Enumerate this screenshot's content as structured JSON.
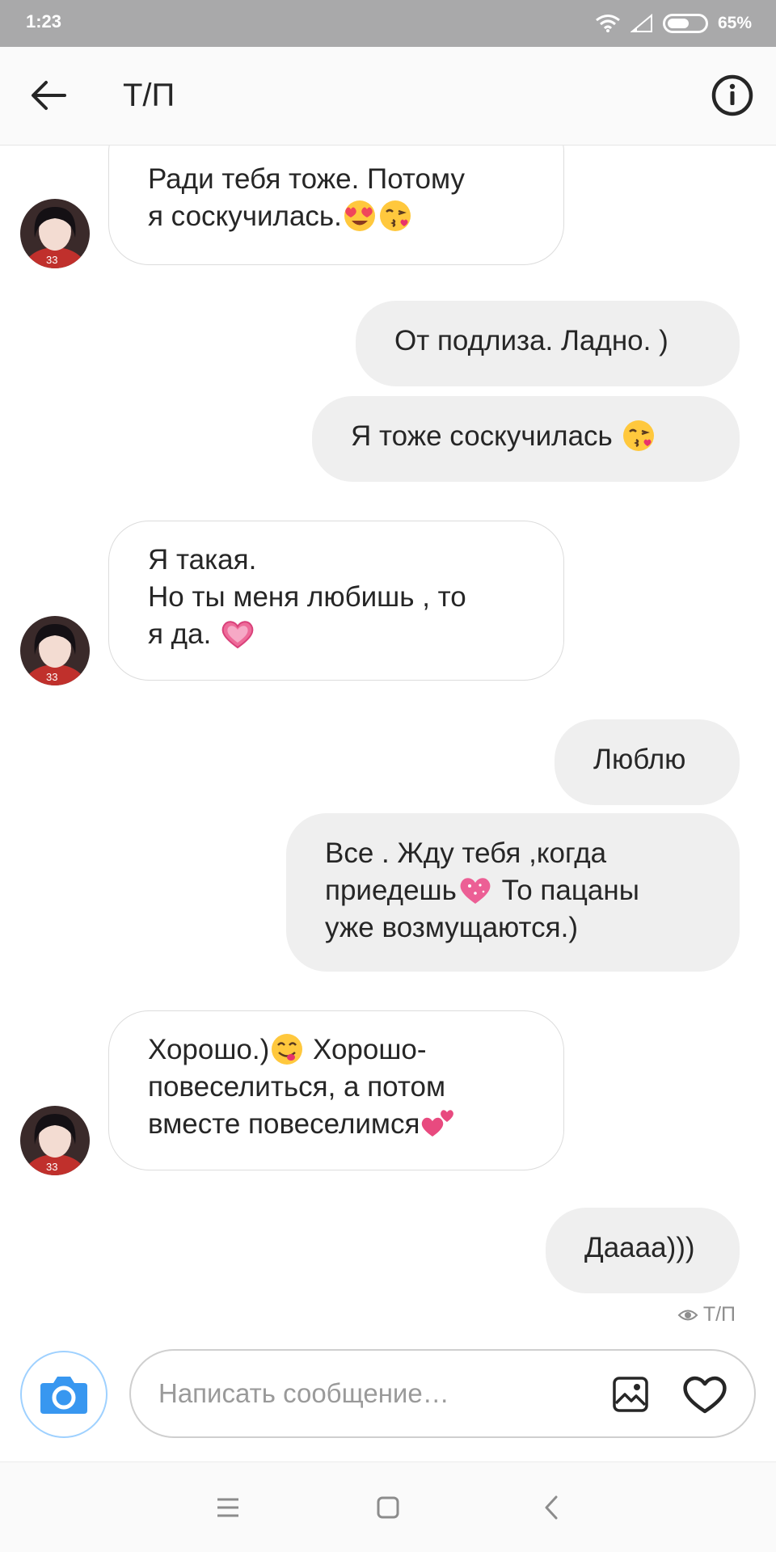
{
  "status_bar": {
    "time": "1:23",
    "battery": "65%",
    "battery_level": 0.65
  },
  "header": {
    "title": "Т/П"
  },
  "messages": [
    {
      "direction": "incoming",
      "text": "Ради тебя тоже. Потому\nя соскучилась.",
      "emoji": [
        "heart-eyes-emoji",
        "kiss-emoji"
      ]
    },
    {
      "direction": "outgoing",
      "text": "От подлиза. Ладно. )"
    },
    {
      "direction": "outgoing",
      "text": "Я тоже соскучилась ",
      "emoji": [
        "kiss-emoji"
      ]
    },
    {
      "direction": "incoming",
      "text": "Я такая.\nНо ты меня любишь , то\nя да. ",
      "emoji": [
        "heart-emoji"
      ]
    },
    {
      "direction": "outgoing",
      "text": "Люблю"
    },
    {
      "direction": "outgoing",
      "text_a": "Все . Жду тебя ,когда\nприедешь",
      "text_b": " То пацаны\nуже возмущаются.)",
      "emoji": [
        "sparkling-heart-emoji"
      ]
    },
    {
      "direction": "incoming",
      "text_a": "Хорошо.)",
      "text_b": " Хорошо-\nповеселиться, а потом\nвместе повеселимся",
      "emoji": [
        "yum-face-emoji",
        "two-hearts-emoji"
      ]
    },
    {
      "direction": "outgoing",
      "text": "Даааа)))"
    }
  ],
  "seen": {
    "label": "Т/П"
  },
  "composer": {
    "placeholder": "Написать сообщение…"
  },
  "colors": {
    "accent": "#3897f0",
    "incoming_bubble": "#ffffff",
    "outgoing_bubble": "#efefef",
    "status_bar": "#a9a9aa"
  }
}
